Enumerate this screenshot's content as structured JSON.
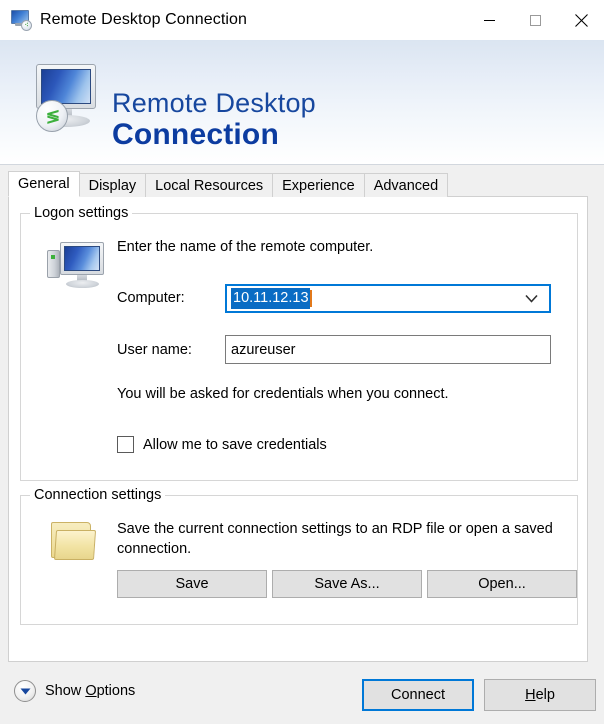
{
  "window": {
    "title": "Remote Desktop Connection",
    "icon": "remote-desktop-icon",
    "controls": {
      "minimize": "minimize-icon",
      "maximize": "maximize-icon",
      "close": "close-icon"
    }
  },
  "banner": {
    "line1": "Remote Desktop",
    "line2": "Connection",
    "icon": "remote-desktop-monitor-icon",
    "badge_glyph": "≶",
    "title_color": "#17479e",
    "bold_color": "#0c3ca0"
  },
  "tabs": [
    {
      "label": "General",
      "active": true
    },
    {
      "label": "Display",
      "active": false
    },
    {
      "label": "Local Resources",
      "active": false
    },
    {
      "label": "Experience",
      "active": false
    },
    {
      "label": "Advanced",
      "active": false
    }
  ],
  "logon_settings": {
    "legend": "Logon settings",
    "icon": "desktop-computer-icon",
    "prompt": "Enter the name of the remote computer.",
    "computer_label": "Computer:",
    "computer_value": "10.11.12.13",
    "computer_dropdown_icon": "chevron-down-icon",
    "user_label": "User name:",
    "user_value": "azureuser",
    "credentials_note": "You will be asked for credentials when you connect.",
    "save_credentials_label": "Allow me to save credentials",
    "save_credentials_checked": false,
    "focus_color": "#0078d7",
    "selection_color": "#0a6cc4"
  },
  "connection_settings": {
    "legend": "Connection settings",
    "icon": "folder-icon",
    "description": "Save the current connection settings to an RDP file or open a saved connection.",
    "buttons": [
      {
        "label": "Save"
      },
      {
        "label": "Save As..."
      },
      {
        "label": "Open..."
      }
    ]
  },
  "footer": {
    "show_options_icon": "chevron-down-circle-icon",
    "show_options_prefix": "Show ",
    "show_options_accel": "O",
    "show_options_suffix": "ptions",
    "connect_label": "Connect",
    "help_prefix": "",
    "help_accel": "H",
    "help_suffix": "elp"
  }
}
